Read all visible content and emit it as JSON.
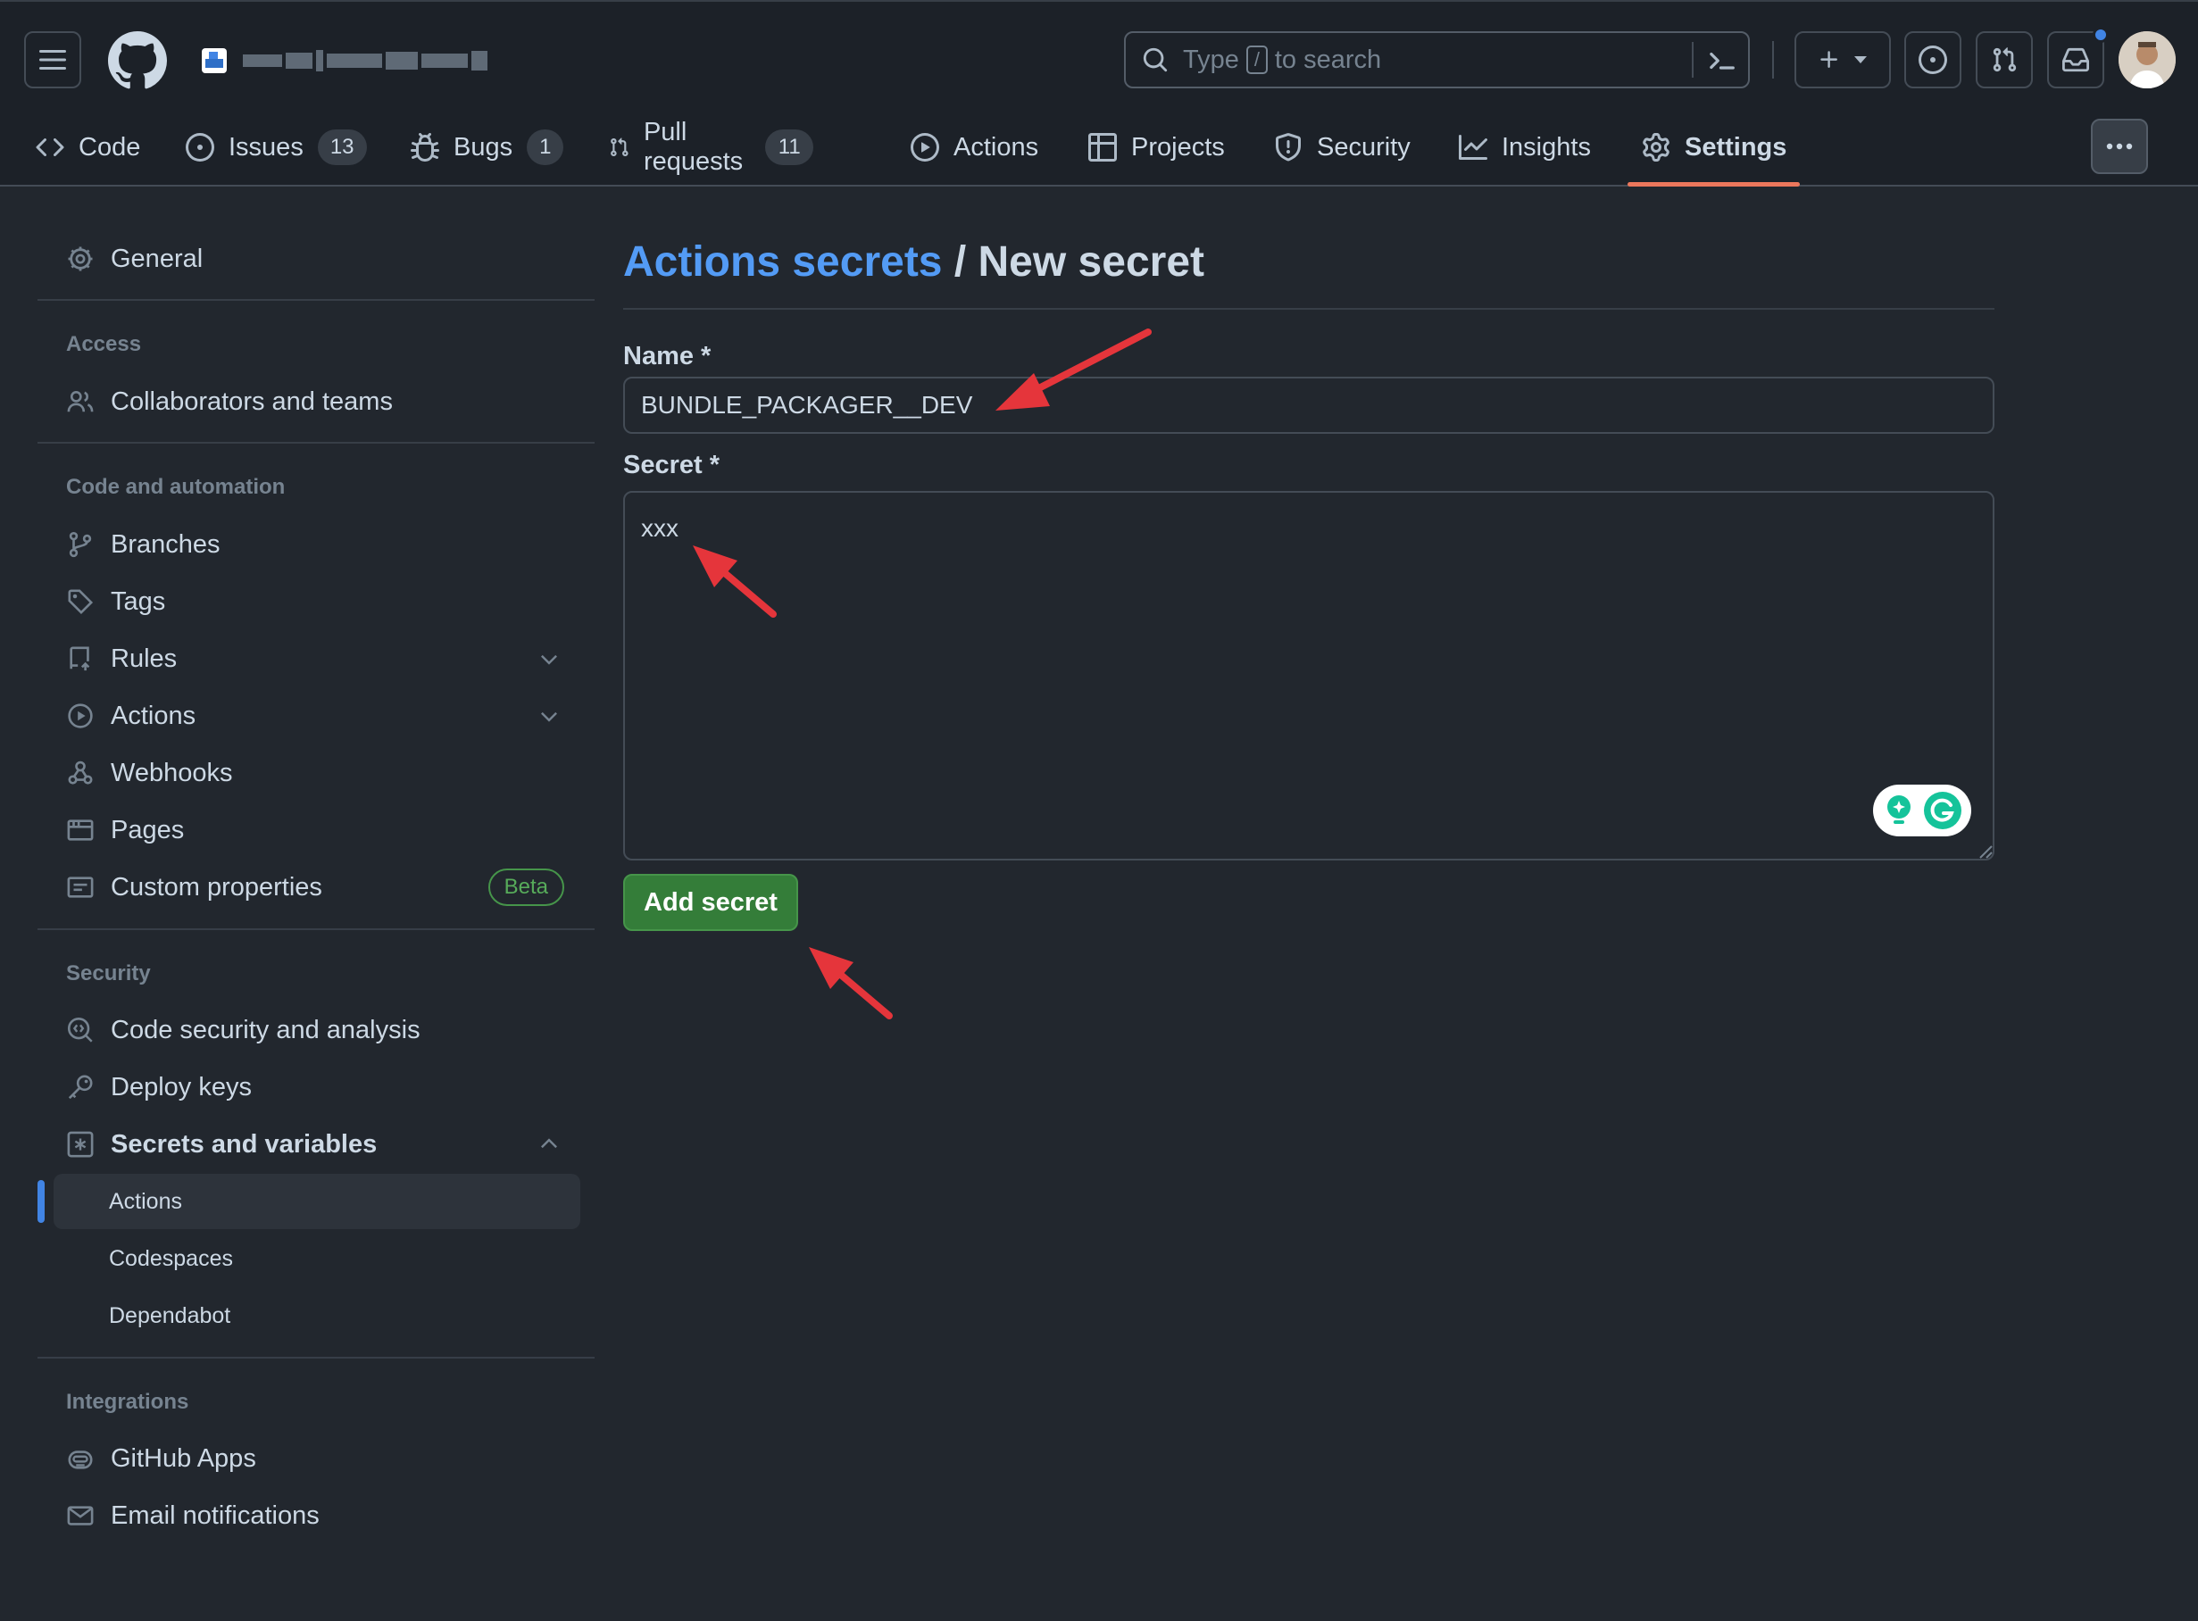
{
  "header": {
    "repo_title": "",
    "search_prefix": "Type",
    "search_key": "/",
    "search_suffix": "to search"
  },
  "tabs": [
    {
      "label": "Code",
      "count": null
    },
    {
      "label": "Issues",
      "count": "13"
    },
    {
      "label": "Bugs",
      "count": "1"
    },
    {
      "label": "Pull requests",
      "count": "11"
    },
    {
      "label": "Actions",
      "count": null
    },
    {
      "label": "Projects",
      "count": null
    },
    {
      "label": "Security",
      "count": null
    },
    {
      "label": "Insights",
      "count": null
    },
    {
      "label": "Settings",
      "count": null
    }
  ],
  "active_tab": "Settings",
  "sidebar": {
    "general": "General",
    "access_heading": "Access",
    "collaborators": "Collaborators and teams",
    "code_automation_heading": "Code and automation",
    "branches": "Branches",
    "tags": "Tags",
    "rules": "Rules",
    "actions": "Actions",
    "webhooks": "Webhooks",
    "pages": "Pages",
    "custom_properties": "Custom properties",
    "beta_badge": "Beta",
    "security_heading": "Security",
    "code_security": "Code security and analysis",
    "deploy_keys": "Deploy keys",
    "secrets_variables": "Secrets and variables",
    "sub_actions": "Actions",
    "sub_codespaces": "Codespaces",
    "sub_dependabot": "Dependabot",
    "integrations_heading": "Integrations",
    "github_apps": "GitHub Apps",
    "email_notifications": "Email notifications"
  },
  "main": {
    "breadcrumb_link": "Actions secrets",
    "breadcrumb_sep": " / ",
    "title": "New secret",
    "name_label": "Name *",
    "name_value": "BUNDLE_PACKAGER__DEV",
    "secret_label": "Secret *",
    "secret_value": "xxx",
    "submit_label": "Add secret"
  },
  "colors": {
    "background": "#22272e",
    "header_bg": "#1c2128",
    "link": "#539bf5",
    "primary_button": "#347d39",
    "tab_underline": "#ec775c",
    "annotation_arrow": "#e5353b",
    "notification_dot": "#4184e4"
  }
}
